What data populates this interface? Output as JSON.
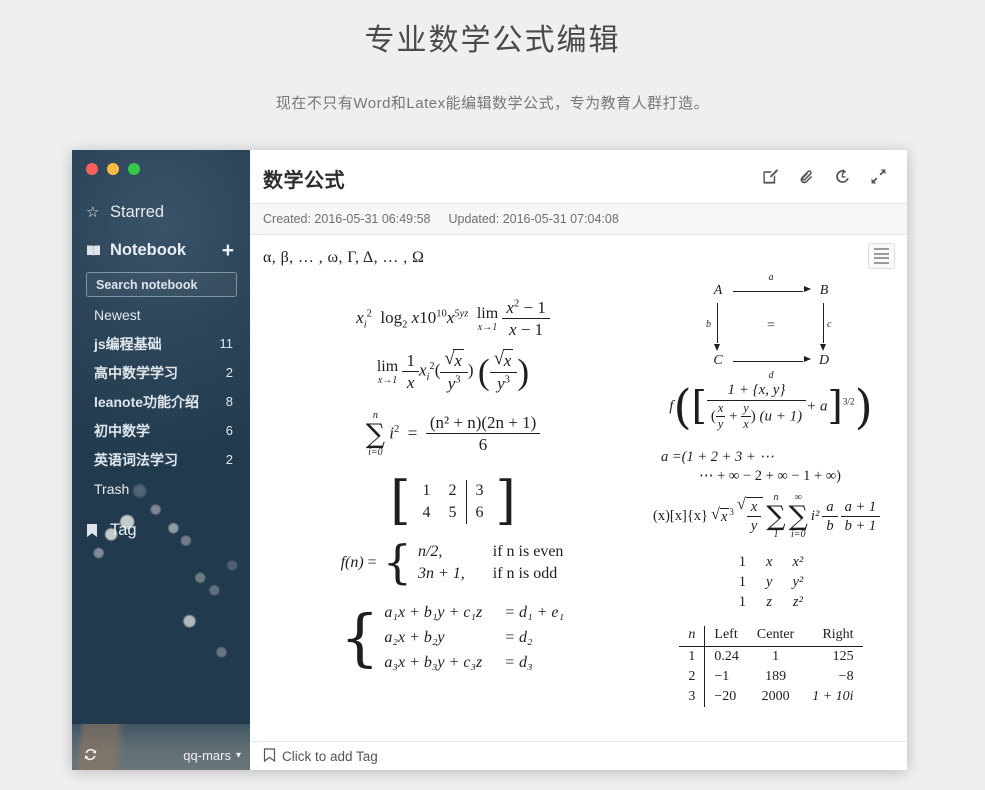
{
  "page": {
    "title": "专业数学公式编辑",
    "subtitle": "现在不只有Word和Latex能编辑数学公式，专为教育人群打造。"
  },
  "sidebar": {
    "starred_label": "Starred",
    "starred_icon": "star-icon",
    "notebook_label": "Notebook",
    "notebook_icon": "notebook-icon",
    "add_notebook_label": "+",
    "search_placeholder": "Search notebook",
    "search_value": "Search notebook",
    "items": [
      {
        "label": "Newest",
        "count": "",
        "bold": false
      },
      {
        "label": "js编程基础",
        "count": "11",
        "bold": true
      },
      {
        "label": "高中数学学习",
        "count": "2",
        "bold": true
      },
      {
        "label": "leanote功能介绍",
        "count": "8",
        "bold": true
      },
      {
        "label": "初中数学",
        "count": "6",
        "bold": true
      },
      {
        "label": "英语词法学习",
        "count": "2",
        "bold": true
      },
      {
        "label": "Trash",
        "count": "",
        "bold": false
      }
    ],
    "tag_label": "Tag",
    "tag_icon": "bookmark-icon",
    "footer": {
      "sync_icon": "sync-icon",
      "username": "qq-mars",
      "chevron": "chevron-down-icon"
    }
  },
  "note": {
    "title": "数学公式",
    "created_label": "Created: 2016-05-31 06:49:58",
    "updated_label": "Updated: 2016-05-31 07:04:08",
    "tools": [
      {
        "name": "edit-icon",
        "title": "Edit"
      },
      {
        "name": "attachment-icon",
        "title": "Attachment"
      },
      {
        "name": "history-icon",
        "title": "History"
      },
      {
        "name": "fullscreen-icon",
        "title": "Fullscreen"
      }
    ],
    "menu_icon": "list-menu-icon",
    "tag_bar": {
      "icon": "tag-icon",
      "label": "Click to add Tag"
    }
  },
  "formulas": {
    "greek_line": "α, β, … , ω, Γ, Δ, … , Ω",
    "eq1": {
      "x_sub_i_sq": "x",
      "log_base": "2",
      "ten_pow": "10",
      "exp10": "10",
      "x_syz": "5yz",
      "lim_op": "lim",
      "lim_under": "x→1",
      "num": "x² − 1",
      "den": "x − 1"
    },
    "eq2": {
      "lim_op": "lim",
      "lim_under": "x→1"
    },
    "eq3": {
      "sum_top": "n",
      "sum_bot": "i=0",
      "num": "(n² + n)(2n + 1)",
      "den": "6"
    },
    "matrix": {
      "rows": [
        [
          "1",
          "2",
          "3"
        ],
        [
          "4",
          "5",
          "6"
        ]
      ]
    },
    "piecewise": {
      "fn": "f(n)",
      "rows": [
        {
          "value": "n/2,",
          "cond": "if n is even"
        },
        {
          "value": "3n + 1,",
          "cond": "if n is odd"
        }
      ]
    },
    "system": {
      "rows": [
        {
          "lhs": "a₁x + b₁y + c₁z",
          "rhs": "= d₁ + e₁"
        },
        {
          "lhs": "a₂x + b₂y",
          "rhs": "= d₂"
        },
        {
          "lhs": "a₃x + b₃y + c₃z",
          "rhs": "= d₃"
        }
      ]
    },
    "diagram": {
      "nodes": {
        "tl": "A",
        "tr": "B",
        "bl": "C",
        "br": "D"
      },
      "arrows": {
        "top": "a",
        "left": "b",
        "right": "c",
        "bottom": "d"
      },
      "center": "="
    },
    "f_bracket": {
      "f": "f",
      "num": "1 + {x, y}",
      "den_left_num": "x",
      "den_left_den": "y",
      "den_right_num": "y",
      "den_right_den": "x",
      "den_tail": "(u + 1)",
      "plus_a": "+ a",
      "power": "3/2"
    },
    "series": {
      "line1": "a =(1 + 2 + 3 + ⋯",
      "line2": "⋯ + ∞ − 2 + ∞ − 1 + ∞)",
      "prefix": "(x)[x]{x}",
      "radical1": "x³",
      "sum1_top": "n",
      "sum1_bot": "1",
      "sum2_top": "∞",
      "sum2_bot": "i=0",
      "i_sq": "i²",
      "frac1_num": "a",
      "frac1_den": "b",
      "frac2_num": "a + 1",
      "frac2_den": "b + 1"
    },
    "vandermonde": {
      "rows": [
        [
          "1",
          "x",
          "x²"
        ],
        [
          "1",
          "y",
          "y²"
        ],
        [
          "1",
          "z",
          "z²"
        ]
      ]
    },
    "data_table": {
      "headers": [
        "n",
        "Left",
        "Center",
        "Right"
      ],
      "rows": [
        [
          "1",
          "0.24",
          "1",
          "125"
        ],
        [
          "2",
          "−1",
          "189",
          "−8"
        ],
        [
          "3",
          "−20",
          "2000",
          "1 + 10i"
        ]
      ]
    }
  }
}
